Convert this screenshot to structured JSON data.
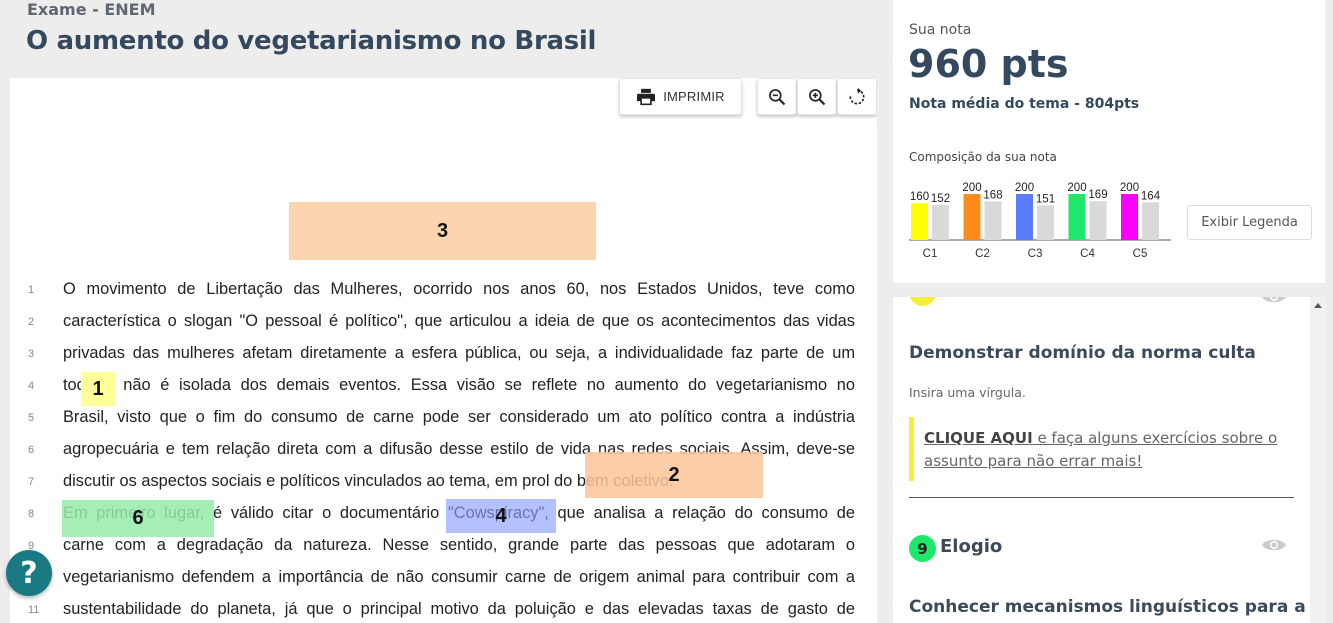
{
  "header": {
    "exam_label": "Exame - ENEM",
    "title": "O aumento do vegetarianismo no Brasil"
  },
  "toolbar": {
    "print_label": "IMPRIMIR",
    "icons": [
      "print-icon",
      "zoom-out-icon",
      "zoom-in-icon",
      "rotate-icon"
    ]
  },
  "essay": {
    "markers": [
      "3",
      "2",
      "1",
      "6",
      "4"
    ],
    "lines": [
      {
        "n": "1",
        "text": " O movimento de Libertação das Mulheres, ocorrido nos anos 60, nos Estados Unidos, teve como"
      },
      {
        "n": "2",
        "text": "característica o slogan \"O pessoal é político\", que articulou a ideia de que os acontecimentos das vidas"
      },
      {
        "n": "3",
        "text": "privadas das mulheres afetam diretamente a esfera pública, ou seja, a individualidade faz parte de um"
      },
      {
        "n": "4",
        "text": "todo e não é isolada dos demais eventos. Essa visão se reflete no aumento do vegetarianismo no"
      },
      {
        "n": "5",
        "text": "Brasil, visto que o fim do consumo de carne pode ser considerado um ato político contra a indústria"
      },
      {
        "n": "6",
        "text": "agropecuária e tem relação direta com a difusão desse estilo de vida nas redes sociais. Assim, deve-se"
      },
      {
        "n": "7",
        "text": "discutir os aspectos sociais e políticos vinculados ao tema, em prol do bem coletivo."
      },
      {
        "n": "8",
        "text": "Em primeiro lugar, é válido citar o documentário \"Cowspiracy\", que analisa a relação do consumo de"
      },
      {
        "n": "9",
        "text": "carne com a degradação da natureza. Nesse sentido, grande parte das pessoas que adotaram o"
      },
      {
        "n": "10",
        "text": "vegetarianismo defendem a importância de não consumir carne de origem animal para contribuir com a"
      },
      {
        "n": "11",
        "text": "sustentabilidade do planeta, já que o principal motivo da poluição e das elevadas taxas de gasto de"
      }
    ]
  },
  "help": {
    "icon": "question-icon",
    "symbol": "?"
  },
  "score": {
    "label": "Sua nota",
    "value": "960 pts",
    "average": "Nota média do tema - 804pts",
    "composition_label": "Composição da sua nota",
    "legend_button": "Exibir Legenda"
  },
  "chart_data": {
    "type": "bar",
    "categories": [
      "C1",
      "C2",
      "C3",
      "C4",
      "C5"
    ],
    "series": [
      {
        "values": [
          160,
          200,
          200,
          200,
          200
        ],
        "colors": [
          "#ffff00",
          "#ff8c1a",
          "#5c7cff",
          "#1de86a",
          "#ff00ff"
        ]
      },
      {
        "values": [
          152,
          168,
          151,
          169,
          164
        ],
        "color": "#d9d9d9"
      }
    ],
    "ylim": [
      0,
      200
    ],
    "data_labels": true
  },
  "competency": {
    "title": "Demonstrar domínio da norma culta",
    "hint": "Insira uma vírgula.",
    "callout_link": "CLIQUE AQUI",
    "callout_rest": " e faça alguns exercícios sobre o assunto para não errar mais!",
    "accent": "#f5ee3a"
  },
  "competency9": {
    "number": "9",
    "title": "Elogio",
    "subtitle": "Conhecer mecanismos linguísticos para a",
    "accent": "#1de86a"
  }
}
